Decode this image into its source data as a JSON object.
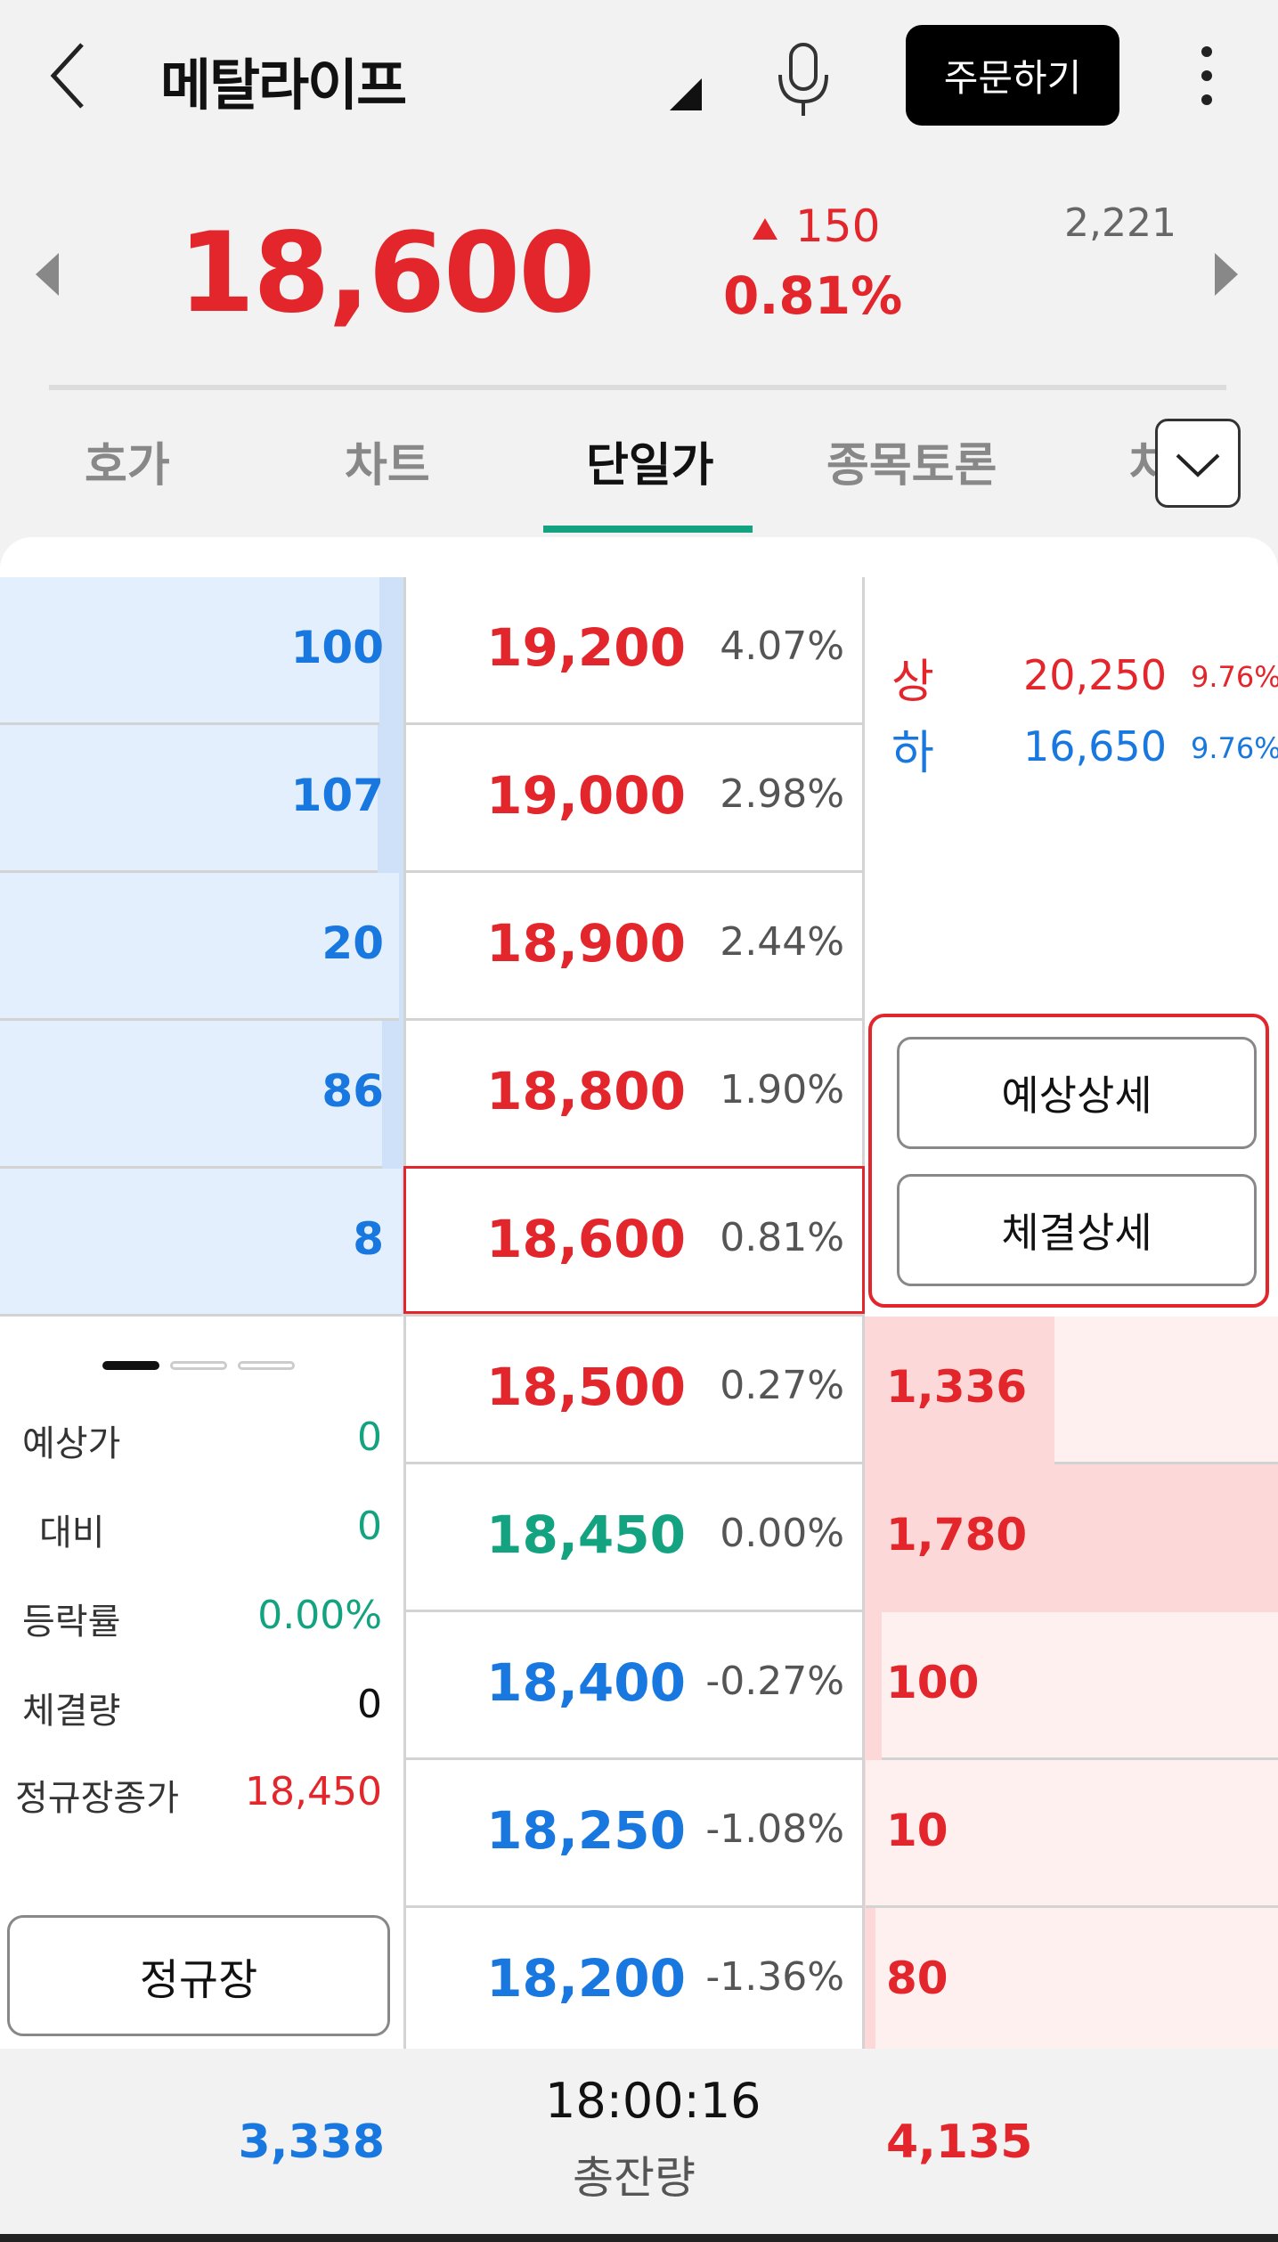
{
  "header": {
    "stock_name": "메탈라이프",
    "order_label": "주문하기"
  },
  "price": {
    "current": "18,600",
    "change": "150",
    "change_pct": "0.81%",
    "volume": "2,221"
  },
  "tabs": [
    {
      "label": "호가"
    },
    {
      "label": "차트"
    },
    {
      "label": "단일가"
    },
    {
      "label": "종목토론"
    },
    {
      "label": "차"
    }
  ],
  "orderbook": {
    "sell_rows": [
      {
        "qty": "100",
        "price": "19,200",
        "pct": "4.07%",
        "bar_pct": 6
      },
      {
        "qty": "107",
        "price": "19,000",
        "pct": "2.98%",
        "bar_pct": 6.5
      },
      {
        "qty": "20",
        "price": "18,900",
        "pct": "2.44%",
        "bar_pct": 1.2
      },
      {
        "qty": "86",
        "price": "18,800",
        "pct": "1.90%",
        "bar_pct": 5.2
      },
      {
        "qty": "8",
        "price": "18,600",
        "pct": "0.81%",
        "bar_pct": 0.5
      }
    ],
    "buy_rows": [
      {
        "price": "18,500",
        "pct": "0.27%",
        "qty": "1,336",
        "price_color": "red",
        "bar_pct": 46
      },
      {
        "price": "18,450",
        "pct": "0.00%",
        "qty": "1,780",
        "price_color": "green",
        "bar_pct": 100
      },
      {
        "price": "18,400",
        "pct": "-0.27%",
        "qty": "100",
        "price_color": "blue",
        "bar_pct": 4
      },
      {
        "price": "18,250",
        "pct": "-1.08%",
        "qty": "10",
        "price_color": "blue",
        "bar_pct": 0.3
      },
      {
        "price": "18,200",
        "pct": "-1.36%",
        "qty": "80",
        "price_color": "blue",
        "bar_pct": 2.5
      }
    ]
  },
  "limits": {
    "upper_label": "상",
    "upper_price": "20,250",
    "upper_pct": "9.76%",
    "lower_label": "하",
    "lower_price": "16,650",
    "lower_pct": "9.76%"
  },
  "details": {
    "expected_label": "예상상세",
    "executed_label": "체결상세"
  },
  "info": {
    "expected_price_label": "예상가",
    "expected_price": "0",
    "diff_label": "대비",
    "diff": "0",
    "rate_label": "등락률",
    "rate": "0.00%",
    "exec_qty_label": "체결량",
    "exec_qty": "0",
    "regular_close_label": "정규장종가",
    "regular_close": "18,450",
    "regular_button": "정규장"
  },
  "footer": {
    "total_sell": "3,338",
    "time": "18:00:16",
    "total_label": "총잔량",
    "total_buy": "4,135"
  },
  "colors": {
    "up": "#e2262b",
    "down": "#1878e0",
    "flat": "#13a380",
    "accent": "#13a380"
  }
}
